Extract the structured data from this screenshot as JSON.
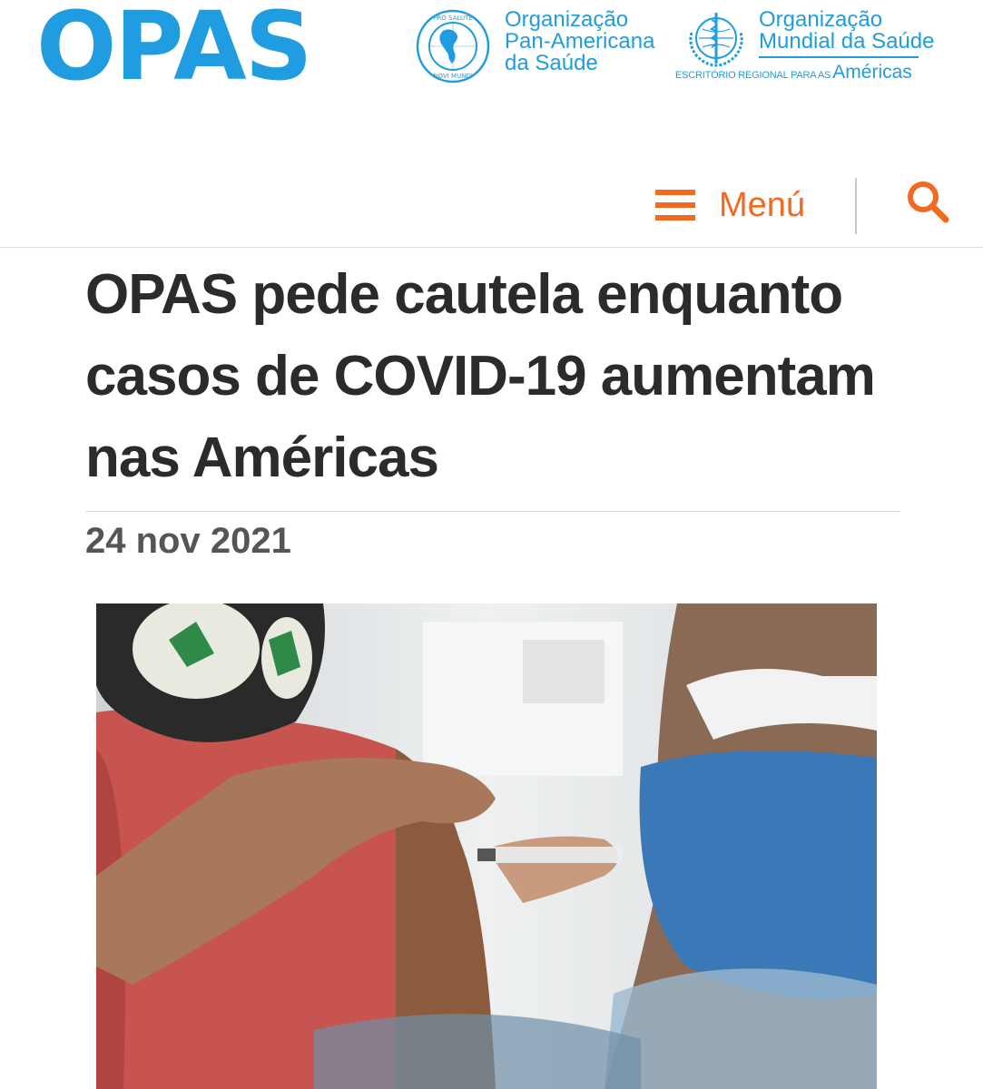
{
  "header": {
    "brand": "OPAS",
    "paho": {
      "lines": [
        "Organização",
        "Pan-Americana",
        "da Saúde"
      ],
      "emblem_top": "PRO SALUTE",
      "emblem_bottom": "NOVI MUNDI"
    },
    "who": {
      "lines": [
        "Organização",
        "Mundial da Saúde"
      ],
      "subline": "ESCRITÓRIO REGIONAL PARA AS",
      "region": "Américas"
    },
    "brand_color": "#1f9de0"
  },
  "nav": {
    "menu_label": "Menú",
    "menu_icon": "hamburger-icon",
    "search_icon": "search-icon",
    "accent_color": "#f26a21"
  },
  "article": {
    "title": "OPAS pede cautela enquanto casos de COVID-19 aumentam nas Américas",
    "date": "24 nov 2021"
  }
}
